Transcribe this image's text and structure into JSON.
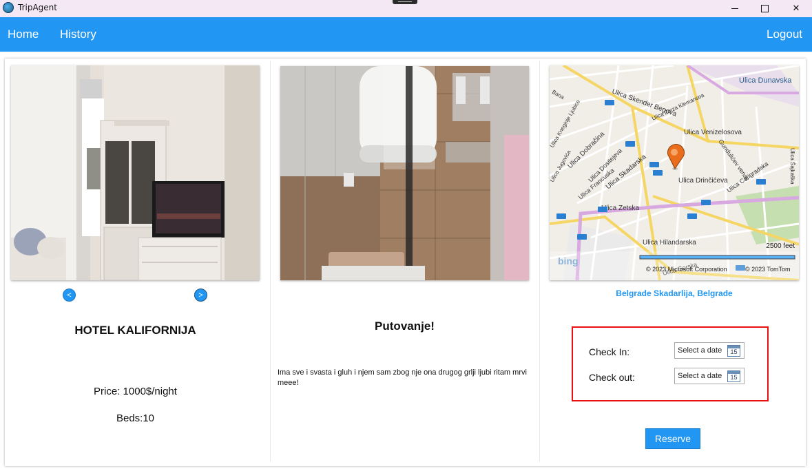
{
  "window": {
    "title": "TripAgent"
  },
  "nav": {
    "home": "Home",
    "history": "History",
    "logout": "Logout"
  },
  "hotel": {
    "name": "HOTEL KALIFORNIJA",
    "price": "Price: 1000$/night",
    "beds": "Beds:10",
    "prev_label": "<",
    "next_label": ">"
  },
  "trip": {
    "title": "Putovanje!",
    "description": "Ima sve i svasta i gluh i njem sam zbog nje ona drugog grlji ljubi ritam mrvi meee!"
  },
  "map": {
    "location": "Belgrade Skadarlija, Belgrade",
    "scale": "2500 feet",
    "copyright_ms": "© 2023 Microsoft Corporation",
    "copyright_tomtom": "© 2023 TomTom",
    "logo": "bing",
    "streets": [
      "Ulica Dunavska",
      "Ulica Skender Begova",
      "Ulica Zorza Klemansoa",
      "Ulica Venizelosova",
      "Ulica Dobračina",
      "Ulica Dositejeva",
      "Ulica Francuska",
      "Ulica Skadarska",
      "Gundulićev venac",
      "Ulica Carigradska",
      "Ulica Drinčićeva",
      "Ulica Zetska",
      "Ulica Hilandarska",
      "Ulica Kneginje Ljubice",
      "Ulica Jugovića",
      "Ulica Šajkaška",
      "Bana",
      "Ulica Gorska"
    ]
  },
  "booking": {
    "check_in_label": "Check In:",
    "check_out_label": "Check out:",
    "date_placeholder": "Select a date",
    "calendar_day": "15",
    "reserve": "Reserve"
  },
  "colors": {
    "accent": "#2196f3",
    "highlight_border": "#e81010",
    "titlebar": "#f3e8f3"
  }
}
